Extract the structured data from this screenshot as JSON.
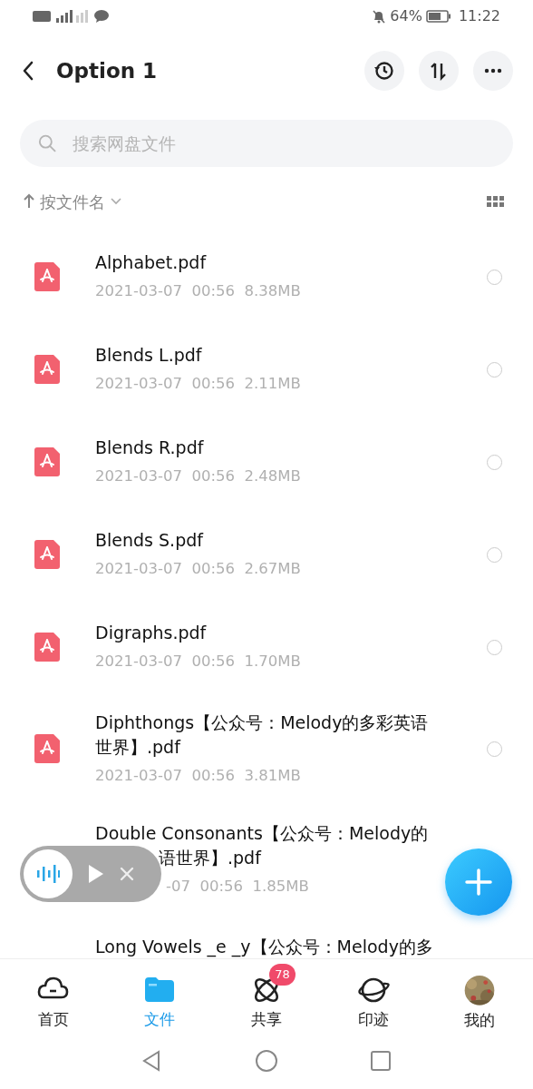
{
  "status_bar": {
    "battery": "64%",
    "time": "11:22"
  },
  "header": {
    "title": "Option 1"
  },
  "search": {
    "placeholder": "搜索网盘文件"
  },
  "sort": {
    "label": "按文件名"
  },
  "files": [
    {
      "name": [
        "Alphabet.pdf"
      ],
      "meta": "2021-03-07  00:56  8.38MB",
      "selected": false,
      "covered": false
    },
    {
      "name": [
        "Blends L.pdf"
      ],
      "meta": "2021-03-07  00:56  2.11MB",
      "selected": false,
      "covered": false
    },
    {
      "name": [
        "Blends R.pdf"
      ],
      "meta": "2021-03-07  00:56  2.48MB",
      "selected": false,
      "covered": false
    },
    {
      "name": [
        "Blends S.pdf"
      ],
      "meta": "2021-03-07  00:56  2.67MB",
      "selected": false,
      "covered": false
    },
    {
      "name": [
        "Digraphs.pdf"
      ],
      "meta": "2021-03-07  00:56  1.70MB",
      "selected": false,
      "covered": false
    },
    {
      "name": [
        "Diphthongs【公众号：Melody的多彩英语",
        "世界】.pdf"
      ],
      "meta": "2021-03-07  00:56  3.81MB",
      "selected": false,
      "covered": false
    },
    {
      "name": [
        "Double Consonants【公众号：Melody的",
        "语世界】.pdf"
      ],
      "meta": "-07  00:56  1.85MB",
      "covered": true
    },
    {
      "name": [
        "Long Vowels _e _y【公众号：Melody的多"
      ]
    }
  ],
  "tabs": [
    {
      "label": "首页",
      "selected": false
    },
    {
      "label": "文件",
      "selected": true
    },
    {
      "label": "共享",
      "selected": false,
      "badge": "78"
    },
    {
      "label": "印迹",
      "selected": false
    },
    {
      "label": "我的",
      "selected": false
    }
  ]
}
